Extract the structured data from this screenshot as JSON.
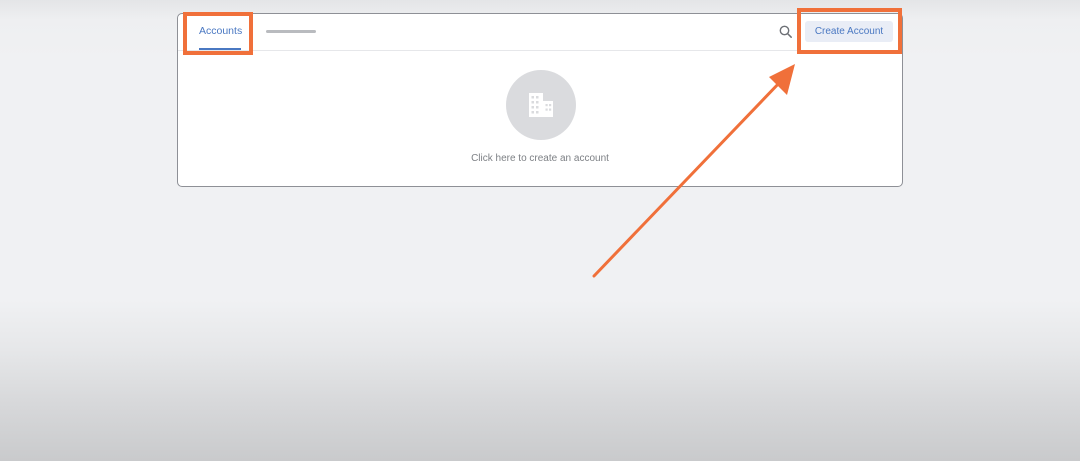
{
  "header": {
    "tab_label": "Accounts",
    "create_button_label": "Create Account"
  },
  "empty_state": {
    "message": "Click here to create an account",
    "icon": "building-icon"
  },
  "annotations": {
    "highlight_color": "#f0703a",
    "arrow_color": "#f0703a"
  },
  "colors": {
    "accent": "#4a78c2",
    "button_background": "#e9edf6"
  }
}
